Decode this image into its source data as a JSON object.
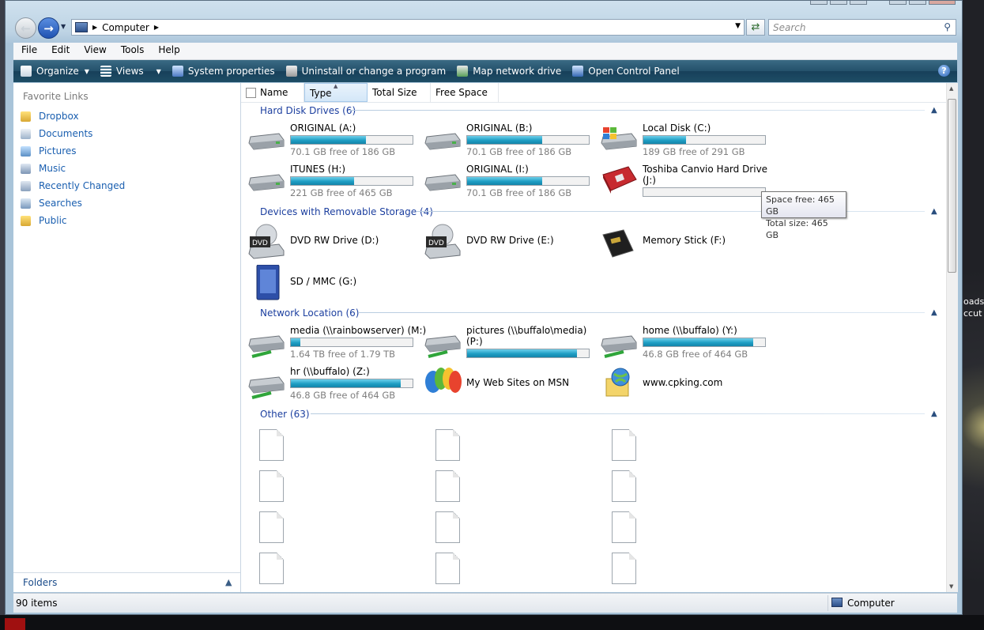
{
  "address": {
    "location": "Computer"
  },
  "search": {
    "placeholder": "Search"
  },
  "menu": [
    "File",
    "Edit",
    "View",
    "Tools",
    "Help"
  ],
  "toolbar": {
    "organize": "Organize",
    "views": "Views",
    "system_properties": "System properties",
    "uninstall": "Uninstall or change a program",
    "map_drive": "Map network drive",
    "control_panel": "Open Control Panel"
  },
  "favorites": {
    "title": "Favorite Links",
    "items": [
      "Dropbox",
      "Documents",
      "Pictures",
      "Music",
      "Recently Changed",
      "Searches",
      "Public"
    ]
  },
  "folders_label": "Folders",
  "columns": [
    "Name",
    "Type",
    "Total Size",
    "Free Space"
  ],
  "groups": {
    "hdd": "Hard Disk Drives (6)",
    "removable": "Devices with Removable Storage (4)",
    "network": "Network Location (6)",
    "other": "Other (63)"
  },
  "drives": [
    {
      "name": "ORIGINAL (A:)",
      "free": "70.1 GB free of 186 GB",
      "used": 0.62
    },
    {
      "name": "ORIGINAL (B:)",
      "free": "70.1 GB free of 186 GB",
      "used": 0.62
    },
    {
      "name": "Local Disk (C:)",
      "free": "189 GB free of 291 GB",
      "used": 0.35
    },
    {
      "name": "ITUNES (H:)",
      "free": "221 GB free of 465 GB",
      "used": 0.52
    },
    {
      "name": "ORIGINAL (I:)",
      "free": "70.1 GB free of 186 GB",
      "used": 0.62
    },
    {
      "name": "Toshiba Canvio Hard Drive",
      "name2": "(J:)",
      "used": 0.0
    }
  ],
  "removable": [
    {
      "name": "DVD RW Drive (D:)"
    },
    {
      "name": "DVD RW Drive (E:)"
    },
    {
      "name": "Memory Stick (F:)"
    },
    {
      "name": "SD / MMC (G:)"
    }
  ],
  "network": [
    {
      "name": "media (\\\\rainbowserver) (M:)",
      "free": "1.64 TB free of 1.79 TB",
      "used": 0.08
    },
    {
      "name": "pictures (\\\\buffalo\\media)",
      "name2": "(P:)",
      "used": 0.9
    },
    {
      "name": "home (\\\\buffalo) (Y:)",
      "free": "46.8 GB free of 464 GB",
      "used": 0.9
    },
    {
      "name": "hr (\\\\buffalo) (Z:)",
      "free": "46.8 GB free of 464 GB",
      "used": 0.9
    },
    {
      "name": "My Web Sites on MSN"
    },
    {
      "name": "www.cpking.com"
    }
  ],
  "tooltip": {
    "line1": "Space free: 465 GB",
    "line2": "Total size: 465 GB"
  },
  "status": {
    "count": "90 items",
    "location": "Computer"
  },
  "desktop": {
    "line1": "oads",
    "line2": "ccut"
  },
  "colors": {
    "accent": "#1c3f9f",
    "bar": "#1f9ec4",
    "toolbar": "#24516b"
  }
}
